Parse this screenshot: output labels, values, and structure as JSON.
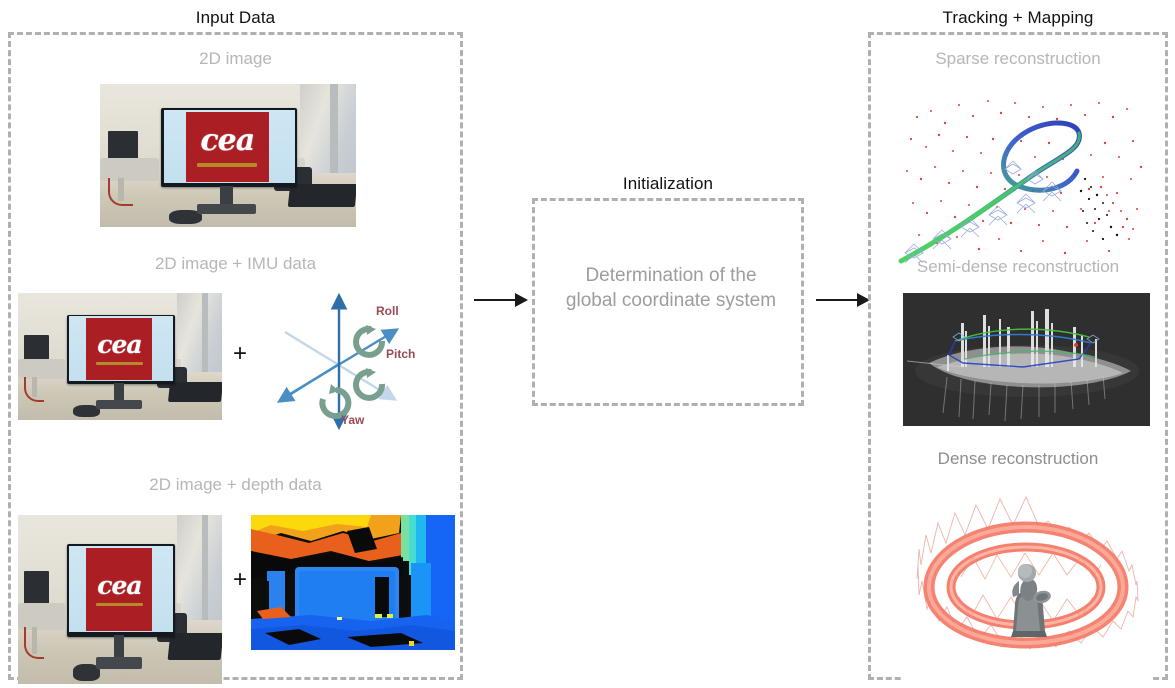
{
  "diagram": {
    "kind": "visual-slam-pipeline",
    "background": "#ffffff",
    "accent_dash_color": "#b0b0b0",
    "label_color": "#b6b6b6",
    "title_color": "#111111"
  },
  "panels": {
    "input": {
      "title": "Input Data",
      "items": [
        {
          "label": "2D image",
          "kind": "photo"
        },
        {
          "label": "2D image + IMU data",
          "kind": "photo+imu",
          "operator": "+"
        },
        {
          "label": "2D image + depth data",
          "kind": "photo+depth",
          "operator": "+"
        }
      ]
    },
    "initialization": {
      "title": "Initialization",
      "body": "Determination of the global coordinate system"
    },
    "tracking": {
      "title": "Tracking + Mapping",
      "items": [
        {
          "label": "Sparse reconstruction"
        },
        {
          "label": "Semi-dense reconstruction"
        },
        {
          "label": "Dense reconstruction"
        }
      ]
    }
  },
  "imu": {
    "labels": {
      "roll": "Roll",
      "pitch": "Pitch",
      "yaw": "Yaw"
    },
    "label_color": "#9b4a55",
    "arc_color": "#79a08f",
    "axis_color": "#3f7fb5",
    "axis_color_light": "#c3d6ea"
  },
  "photo": {
    "logo_text": "cea",
    "logo_bg": "#ab1f24",
    "logo_bar": "#b58a2a",
    "screen_bg": "#cfe6f3"
  },
  "arrows": [
    {
      "name": "input-to-initialization"
    },
    {
      "name": "initialization-to-tracking"
    }
  ]
}
